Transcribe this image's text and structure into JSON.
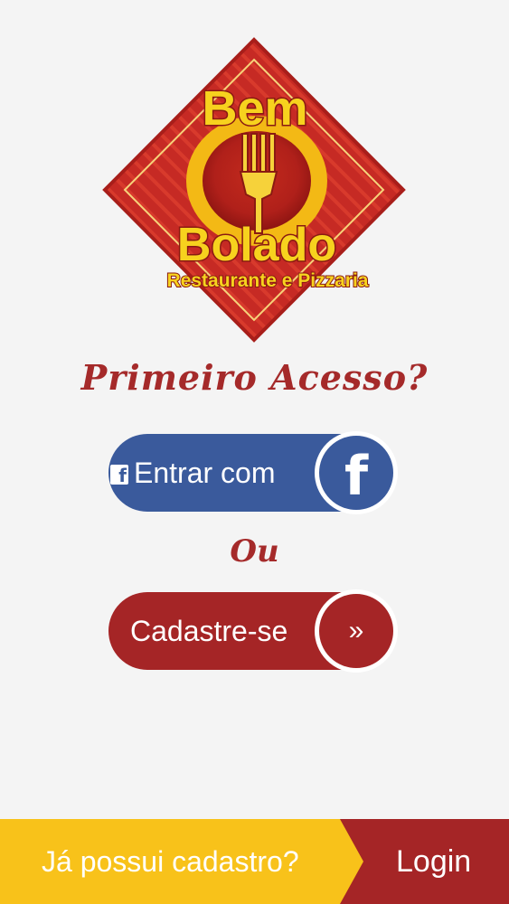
{
  "logo": {
    "line1": "Bem",
    "line2": "Bolado",
    "tagline": "Restaurante e Pizzaria",
    "icon": "fork-plate-icon"
  },
  "first_access_heading": "Primeiro Acesso?",
  "facebook_button": {
    "label": "Entrar com",
    "icon": "facebook-icon",
    "color": "#3a5a9c"
  },
  "or_text": "Ou",
  "register_button": {
    "label": "Cadastre-se",
    "icon": "double-chevron-right-icon",
    "icon_glyph": "»",
    "color": "#a52526"
  },
  "bottom_bar": {
    "question": "Já possui cadastro?",
    "login_label": "Login",
    "left_color": "#f8c21a",
    "right_color": "#a52526"
  }
}
